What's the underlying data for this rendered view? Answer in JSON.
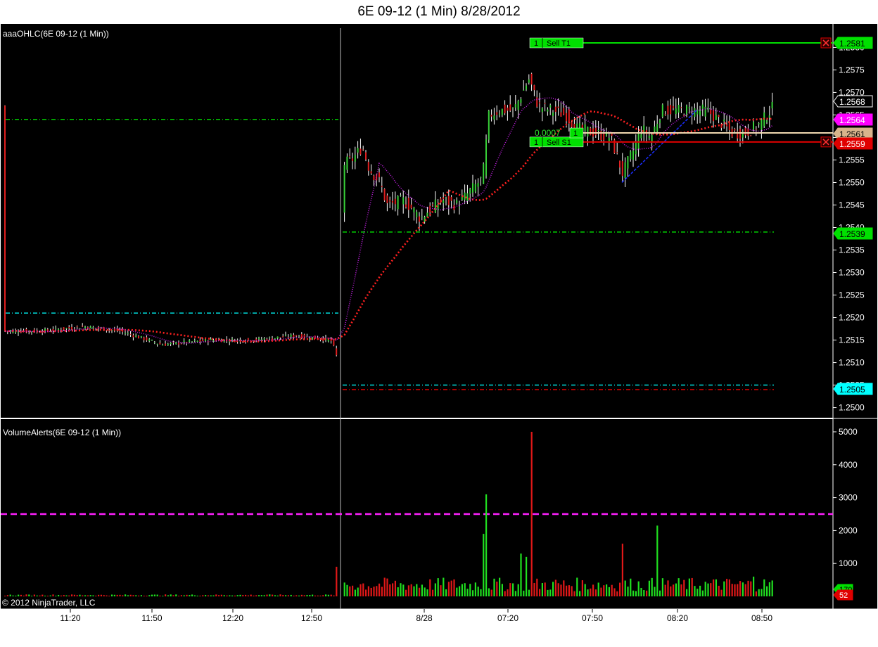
{
  "window": {
    "title": "6E 09-12 (1 Min)  8/28/2012"
  },
  "price_panel": {
    "indicator_label": "aaaOHLC(6E 09-12 (1 Min))",
    "axis": {
      "ticks": [
        "1.2580",
        "1.2575",
        "1.2570",
        "1.2565",
        "1.2560",
        "1.2555",
        "1.2550",
        "1.2545",
        "1.2540",
        "1.2535",
        "1.2530",
        "1.2525",
        "1.2520",
        "1.2515",
        "1.2510",
        "1.2505",
        "1.2500"
      ],
      "ylim": [
        1.24975,
        1.25835
      ]
    },
    "price_tags": [
      {
        "value": "1.2581",
        "color": "#00e000"
      },
      {
        "value": "1.2568",
        "color": "#000000"
      },
      {
        "value": "1.2564",
        "color": "#ff00ff"
      },
      {
        "value": "1.2561",
        "color": "#d8b48c"
      },
      {
        "value": "1.2559",
        "color": "#e00000"
      },
      {
        "value": "1.2539",
        "color": "#00e000"
      },
      {
        "value": "1.2505",
        "color": "#00ffff"
      }
    ],
    "orders": [
      {
        "qty": "1",
        "label": "Sell T1",
        "price": 1.2581,
        "color": "#00e000"
      },
      {
        "qty": "1",
        "label": "Sell S1",
        "price": 1.2559,
        "color": "#e00000"
      }
    ],
    "position": {
      "pnl": "0.0007",
      "qty": "1",
      "price": 1.2561
    },
    "levels": [
      {
        "price": 1.2564,
        "color": "#00c000",
        "session": "prior"
      },
      {
        "price": 1.2521,
        "color": "#00cccc",
        "session": "prior"
      },
      {
        "price": 1.2539,
        "color": "#00c000",
        "session": "current"
      },
      {
        "price": 1.2505,
        "color": "#00cccc",
        "session": "current"
      },
      {
        "price": 1.2504,
        "color": "#e00000",
        "session": "current"
      }
    ]
  },
  "volume_panel": {
    "indicator_label": "VolumeAlerts(6E 09-12 (1 Min))",
    "axis": {
      "ticks": [
        "5000",
        "4000",
        "3000",
        "2000",
        "1000"
      ],
      "ylim": [
        0,
        5350
      ]
    },
    "alert_level": 2500,
    "tags": [
      {
        "value": "170",
        "color": "#00e000"
      },
      {
        "value": "52",
        "color": "#e00000"
      }
    ]
  },
  "time_axis": {
    "labels": [
      "11:20",
      "11:50",
      "12:20",
      "12:50",
      "8/28",
      "07:20",
      "07:50",
      "08:20",
      "08:50"
    ]
  },
  "copyright": "© 2012 NinjaTrader, LLC",
  "chart_data": {
    "type": "candlestick",
    "instrument": "6E 09-12",
    "interval": "1 Min",
    "date": "8/28/2012",
    "key_prices": {
      "high": 1.2577,
      "low": 1.2504,
      "last": 1.2568,
      "prior_session_close": 1.2515
    },
    "volume_peaks": [
      {
        "time": "07:07",
        "volume": 3100,
        "direction": "up"
      },
      {
        "time": "07:28",
        "volume": 5000,
        "direction": "down"
      },
      {
        "time": "08:12",
        "volume": 2150,
        "direction": "up"
      }
    ]
  }
}
